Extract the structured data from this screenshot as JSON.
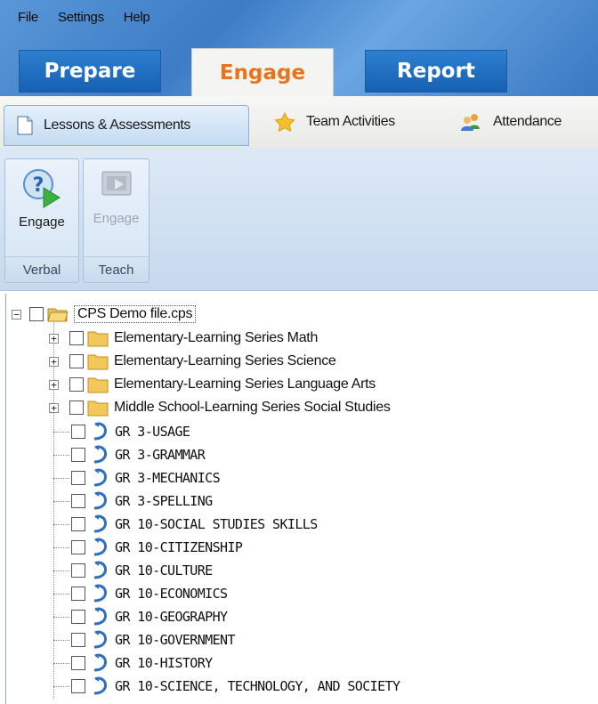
{
  "menu": [
    "File",
    "Settings",
    "Help"
  ],
  "main_tabs": [
    "Prepare",
    "Engage",
    "Report"
  ],
  "sub_tabs": [
    "Lessons & Assessments",
    "Team Activities",
    "Attendance"
  ],
  "ribbon": {
    "groups": [
      {
        "button": "Engage",
        "label": "Verbal",
        "enabled": true
      },
      {
        "button": "Engage",
        "label": "Teach",
        "enabled": false
      }
    ]
  },
  "tree": {
    "root": "CPS Demo file.cps",
    "folders": [
      "Elementary-Learning Series Math",
      "Elementary-Learning Series Science",
      "Elementary-Learning Series Language Arts",
      "Middle School-Learning Series Social Studies"
    ],
    "lessons": [
      "GR 3-USAGE",
      "GR 3-GRAMMAR",
      "GR 3-MECHANICS",
      "GR 3-SPELLING",
      "GR 10-SOCIAL STUDIES SKILLS",
      "GR 10-CITIZENSHIP",
      "GR 10-CULTURE",
      "GR 10-ECONOMICS",
      "GR 10-GEOGRAPHY",
      "GR 10-GOVERNMENT",
      "GR 10-HISTORY",
      "GR 10-SCIENCE, TECHNOLOGY, AND SOCIETY"
    ]
  },
  "colors": {
    "accent": "#e8731a",
    "tab_blue": "#1f6fc4",
    "ribbon": "#d5e4f4"
  }
}
